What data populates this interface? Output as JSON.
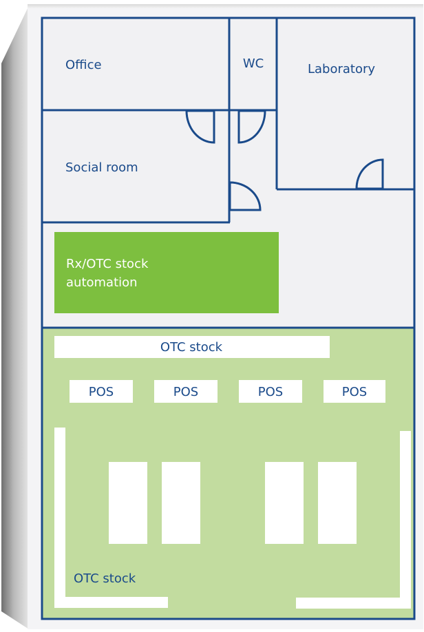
{
  "colors": {
    "wall": "#1a4a8a",
    "floor": "#f1f1f3",
    "retail_area": "#c2dc9f",
    "automation": "#7dbf3f",
    "fixture": "#ffffff",
    "label_dark": "#1a4a8a",
    "label_light": "#ffffff"
  },
  "rooms": {
    "office": "Office",
    "wc": "WC",
    "laboratory": "Laboratory",
    "social_room": "Social room"
  },
  "automation": {
    "line1": "Rx/OTC stock",
    "line2": "automation"
  },
  "retail": {
    "otc_stock_top": "OTC stock",
    "pos": [
      "POS",
      "POS",
      "POS",
      "POS"
    ],
    "otc_stock_bottom": "OTC stock"
  }
}
